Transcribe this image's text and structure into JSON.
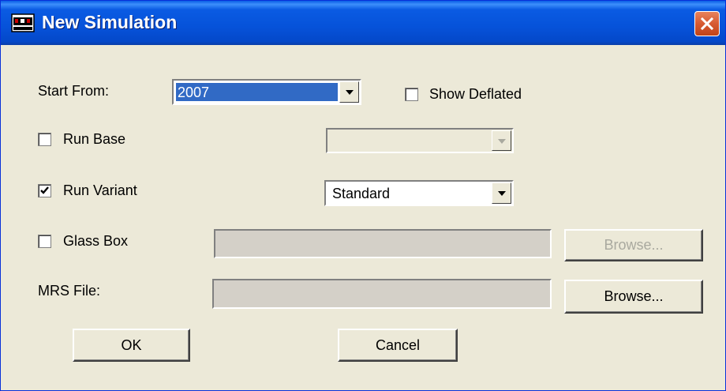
{
  "window": {
    "title": "New Simulation",
    "icon": "app-icon",
    "close_icon": "close-icon"
  },
  "form": {
    "start_from": {
      "label": "Start From:",
      "value": "2007"
    },
    "show_deflated": {
      "label": "Show Deflated",
      "checked": false
    },
    "run_base": {
      "label": "Run Base",
      "checked": false,
      "select_value": ""
    },
    "run_variant": {
      "label": "Run Variant",
      "checked": true,
      "select_value": "Standard"
    },
    "glass_box": {
      "label": "Glass Box",
      "checked": false,
      "path_value": "",
      "browse_label": "Browse..."
    },
    "mrs_file": {
      "label": "MRS File:",
      "path_value": "",
      "browse_label": "Browse..."
    }
  },
  "buttons": {
    "ok_label": "OK",
    "cancel_label": "Cancel"
  },
  "colors": {
    "titlebar": "#0652d9",
    "dialog_bg": "#ece9d8",
    "selection": "#316ac5",
    "close_button": "#d75a32"
  }
}
